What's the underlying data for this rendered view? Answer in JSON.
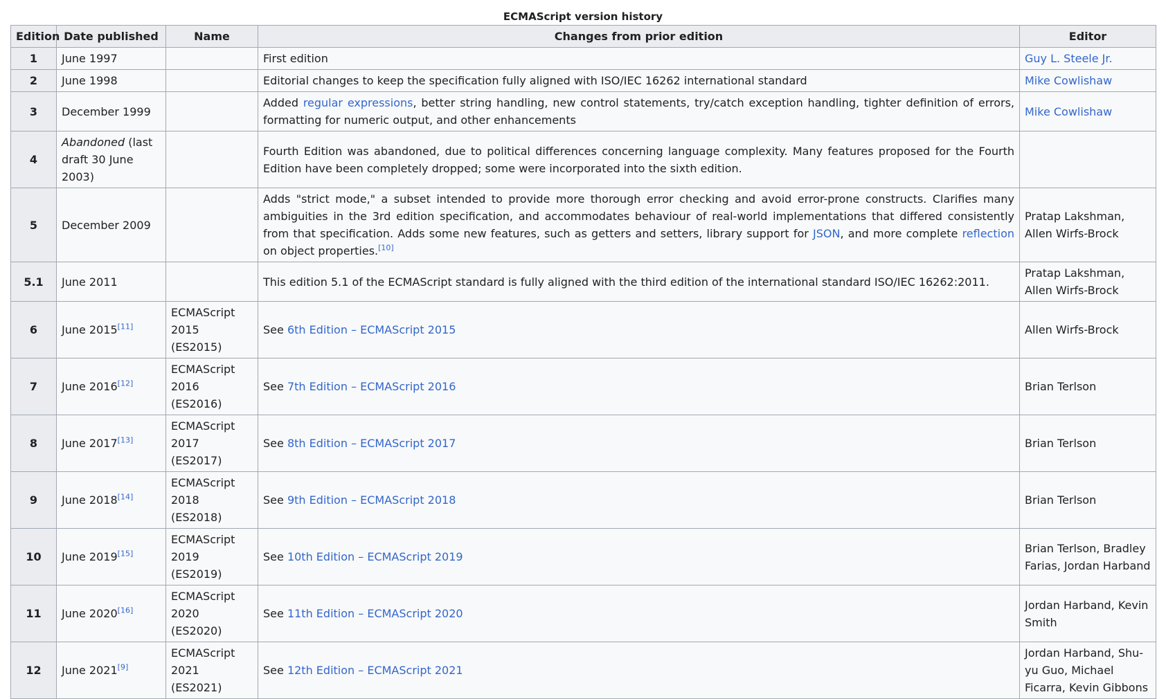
{
  "caption": "ECMAScript version history",
  "headers": {
    "edition": "Edition",
    "date": "Date published",
    "name": "Name",
    "changes": "Changes from prior edition",
    "editor": "Editor"
  },
  "rows": [
    {
      "edition": "1",
      "date": "June 1997",
      "name": "",
      "changes": "First edition",
      "editor": "Guy L. Steele Jr."
    },
    {
      "edition": "2",
      "date": "June 1998",
      "name": "",
      "changes": "Editorial changes to keep the specification fully aligned with ISO/IEC 16262 international standard",
      "editor": "Mike Cowlishaw"
    },
    {
      "edition": "3",
      "date": "December 1999",
      "name": "",
      "changes_pre": "Added ",
      "changes_link": "regular expressions",
      "changes_post": ", better string handling, new control statements, try/catch exception handling, tighter definition of errors, formatting for numeric output, and other enhancements",
      "editor": "Mike Cowlishaw"
    },
    {
      "edition": "4",
      "date_italic": "Abandoned",
      "date_rest": " (last draft 30 June 2003)",
      "name": "",
      "changes": "Fourth Edition was abandoned, due to political differences concerning language complexity. Many features proposed for the Fourth Edition have been completely dropped; some were incorporated into the sixth edition.",
      "editor": ""
    },
    {
      "edition": "5",
      "date": "December 2009",
      "name": "",
      "changes_pre": "Adds \"strict mode,\" a subset intended to provide more thorough error checking and avoid error-prone constructs. Clarifies many ambiguities in the 3rd edition specification, and accommodates behaviour of real-world implementations that differed consistently from that specification. Adds some new features, such as getters and setters, library support for ",
      "changes_link1": "JSON",
      "changes_mid": ", and more complete ",
      "changes_link2": "reflection",
      "changes_post": " on object properties.",
      "changes_ref": "[10]",
      "editor": "Pratap Lakshman, Allen Wirfs-Brock"
    },
    {
      "edition": "5.1",
      "date": "June 2011",
      "name": "",
      "changes": "This edition 5.1 of the ECMAScript standard is fully aligned with the third edition of the international standard ISO/IEC 16262:2011.",
      "editor": "Pratap Lakshman, Allen Wirfs-Brock"
    },
    {
      "edition": "6",
      "date": "June 2015",
      "date_ref": "[11]",
      "name": "ECMAScript 2015 (ES2015)",
      "see": "See ",
      "changes_link": "6th Edition – ECMAScript 2015",
      "editor": "Allen Wirfs-Brock"
    },
    {
      "edition": "7",
      "date": "June 2016",
      "date_ref": "[12]",
      "name": "ECMAScript 2016 (ES2016)",
      "see": "See ",
      "changes_link": "7th Edition – ECMAScript 2016",
      "editor": "Brian Terlson"
    },
    {
      "edition": "8",
      "date": "June 2017",
      "date_ref": "[13]",
      "name": "ECMAScript 2017 (ES2017)",
      "see": "See ",
      "changes_link": "8th Edition – ECMAScript 2017",
      "editor": "Brian Terlson"
    },
    {
      "edition": "9",
      "date": "June 2018",
      "date_ref": "[14]",
      "name": "ECMAScript 2018 (ES2018)",
      "see": "See ",
      "changes_link": "9th Edition – ECMAScript 2018",
      "editor": "Brian Terlson"
    },
    {
      "edition": "10",
      "date": "June 2019",
      "date_ref": "[15]",
      "name": "ECMAScript 2019 (ES2019)",
      "see": "See ",
      "changes_link": "10th Edition – ECMAScript 2019",
      "editor": "Brian Terlson, Bradley Farias, Jordan Harband"
    },
    {
      "edition": "11",
      "date": "June 2020",
      "date_ref": "[16]",
      "name": "ECMAScript 2020 (ES2020)",
      "see": "See ",
      "changes_link": "11th Edition – ECMAScript 2020",
      "editor": "Jordan Harband, Kevin Smith"
    },
    {
      "edition": "12",
      "date": "June 2021",
      "date_ref": "[9]",
      "name": "ECMAScript 2021 (ES2021)",
      "see": "See ",
      "changes_link": "12th Edition – ECMAScript 2021",
      "editor": "Jordan Harband, Shu-yu Guo, Michael Ficarra, Kevin Gibbons"
    }
  ],
  "colors": {
    "link": "#3366cc",
    "header_bg": "#eaecf0",
    "cell_bg": "#f8f9fa",
    "border": "#a2a9b1"
  }
}
